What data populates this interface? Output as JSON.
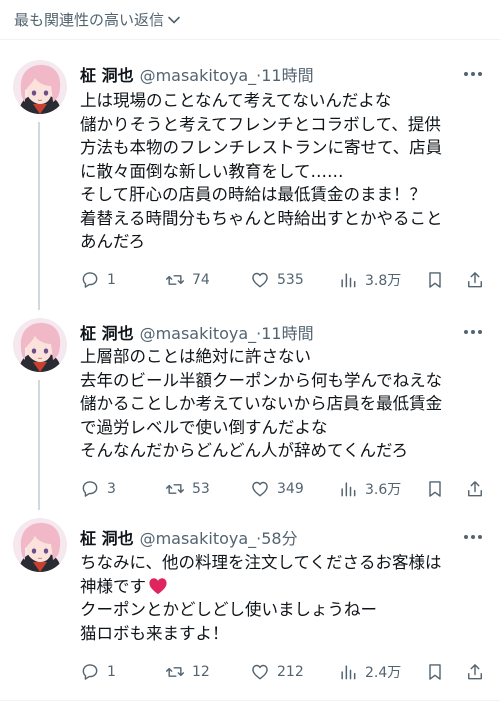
{
  "sort_label": "最も関連性の高い返信",
  "tweets": [
    {
      "name": "柾 洞也",
      "handle": "@masakitoya_",
      "time": "11時間",
      "lines": [
        "上は現場のことなんて考えてないんだよな",
        "儲かりそうと考えてフレンチとコラボして、提供",
        "方法も本物のフレンチレストランに寄せて、店員",
        "に散々面倒な新しい教育をして……",
        "そして肝心の店員の時給は最低賃金のまま！？",
        "着替える時間分もちゃんと時給出すとかやること",
        "あんだろ"
      ],
      "replies": "1",
      "retweets": "74",
      "likes": "535",
      "views": "3.8万"
    },
    {
      "name": "柾 洞也",
      "handle": "@masakitoya_",
      "time": "11時間",
      "lines": [
        "上層部のことは絶対に許さない",
        "去年のビール半額クーポンから何も学んでねえな",
        "儲かることしか考えていないから店員を最低賃金",
        "で過労レベルで使い倒すんだよな",
        "そんなんだからどんどん人が辞めてくんだろ"
      ],
      "replies": "3",
      "retweets": "53",
      "likes": "349",
      "views": "3.6万"
    },
    {
      "name": "柾 洞也",
      "handle": "@masakitoya_",
      "time": "58分",
      "lines": [
        "ちなみに、他の料理を注文してくださるお客様は",
        "神様です",
        "クーポンとかどしどし使いましょうねー",
        "猫ロボも来ますよ！"
      ],
      "replies": "1",
      "retweets": "12",
      "likes": "212",
      "views": "2.4万"
    }
  ],
  "icons": {
    "sort": "chevron-down-icon",
    "more": "more-dots-icon",
    "reply": "reply-icon",
    "retweet": "retweet-icon",
    "like": "heart-icon",
    "views": "views-chart-icon",
    "bookmark": "bookmark-icon",
    "share": "share-icon",
    "emoji": "red-heart-emoji"
  },
  "colors": {
    "text": "#0f1419",
    "secondary": "#536471",
    "divider": "#eff3f4",
    "thread_line": "#cfd9de",
    "heart_emoji": "#e0245e",
    "avatar_hair": "#f1b8c8"
  }
}
